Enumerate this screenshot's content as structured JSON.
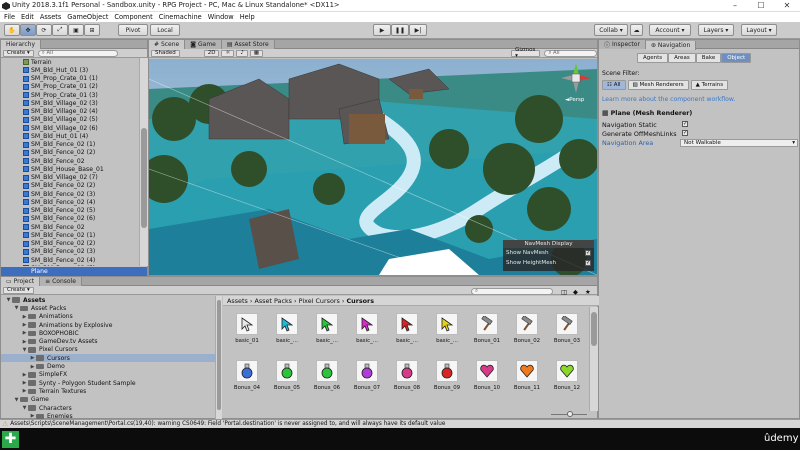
{
  "window": {
    "title": "Unity 2018.3.1f1 Personal - Sandbox.unity - RPG Project - PC, Mac & Linux Standalone* <DX11>",
    "min": "–",
    "max": "☐",
    "close": "✕"
  },
  "menu": [
    "File",
    "Edit",
    "Assets",
    "GameObject",
    "Component",
    "Cinemachine",
    "Window",
    "Help"
  ],
  "toolbar": {
    "pivot": "Pivot",
    "local": "Local",
    "collab": "Collab ▾",
    "account": "Account ▾",
    "layers": "Layers ▾",
    "layout": "Layout ▾"
  },
  "hierarchy": {
    "tab": "Hierarchy",
    "create": "Create ▾",
    "search_placeholder": "All",
    "items": [
      "Terrain",
      "SM_Bld_Hut_01 (3)",
      "SM_Prop_Crate_01 (1)",
      "SM_Prop_Crate_01 (2)",
      "SM_Prop_Crate_01 (3)",
      "SM_Bld_Village_02 (3)",
      "SM_Bld_Village_02 (4)",
      "SM_Bld_Village_02 (5)",
      "SM_Bld_Village_02 (6)",
      "SM_Bld_Hut_01 (4)",
      "SM_Bld_Fence_02 (1)",
      "SM_Bld_Fence_02 (2)",
      "SM_Bld_Fence_02",
      "SM_Bld_House_Base_01",
      "SM_Bld_Village_02 (7)",
      "SM_Bld_Fence_02 (2)",
      "SM_Bld_Fence_02 (3)",
      "SM_Bld_Fence_02 (4)",
      "SM_Bld_Fence_02 (5)",
      "SM_Bld_Fence_02 (6)",
      "SM_Bld_Fence_02",
      "SM_Bld_Fence_02 (1)",
      "SM_Bld_Fence_02 (2)",
      "SM_Bld_Fence_02 (3)",
      "SM_Bld_Fence_02 (4)",
      "SM_Bld_Fence_02 (5)"
    ],
    "selected": "Plane"
  },
  "scene": {
    "tabs": [
      "Scene",
      "Game",
      "Asset Store"
    ],
    "shading": "Shaded",
    "mode_2d": "2D",
    "gizmos": "Gizmos ▾",
    "search_placeholder": "All",
    "persp": "◄Persp",
    "navmesh_display": {
      "title": "NavMesh Display",
      "show_navmesh": "Show NavMesh",
      "show_heightmesh": "Show HeightMesh"
    }
  },
  "inspector": {
    "tabs": [
      "Inspector",
      "Navigation"
    ],
    "subtabs": [
      "Agents",
      "Areas",
      "Bake",
      "Object"
    ],
    "scene_filter_label": "Scene Filter:",
    "filter_all": "All",
    "filter_mesh": "Mesh Renderers",
    "filter_terrains": "Terrains",
    "learn_more": "Learn more about the component workflow.",
    "object_title": "Plane (Mesh Renderer)",
    "nav_static": "Navigation Static",
    "offmesh": "Generate OffMeshLinks",
    "nav_area_label": "Navigation Area",
    "nav_area_value": "Not Walkable"
  },
  "project": {
    "tabs": [
      "Project",
      "Console"
    ],
    "create": "Create ▾",
    "tree": [
      {
        "label": "Assets",
        "depth": 0,
        "open": true
      },
      {
        "label": "Asset Packs",
        "depth": 1,
        "open": true
      },
      {
        "label": "Animations",
        "depth": 2,
        "open": false
      },
      {
        "label": "Animations by Explosive",
        "depth": 2,
        "open": false
      },
      {
        "label": "BOXOPHOBIC",
        "depth": 2,
        "open": false
      },
      {
        "label": "GameDev.tv Assets",
        "depth": 2,
        "open": false
      },
      {
        "label": "Pixel Cursors",
        "depth": 2,
        "open": true
      },
      {
        "label": "Cursors",
        "depth": 3,
        "open": false,
        "selected": true
      },
      {
        "label": "Demo",
        "depth": 3,
        "open": false
      },
      {
        "label": "SimpleFX",
        "depth": 2,
        "open": false
      },
      {
        "label": "Synty - Polygon Student Sample",
        "depth": 2,
        "open": false
      },
      {
        "label": "Terrain Textures",
        "depth": 2,
        "open": false
      },
      {
        "label": "Game",
        "depth": 1,
        "open": true
      },
      {
        "label": "Characters",
        "depth": 2,
        "open": true
      },
      {
        "label": "Enemies",
        "depth": 3,
        "open": false
      }
    ],
    "breadcrumb": [
      "Assets",
      "Asset Packs",
      "Pixel Cursors",
      "Cursors"
    ],
    "assets_row1": [
      {
        "label": "basic_01",
        "color": "#e8e8e8",
        "shape": "arrow"
      },
      {
        "label": "basic_...",
        "color": "#22b8d8",
        "shape": "arrow"
      },
      {
        "label": "basic_...",
        "color": "#2bc43a",
        "shape": "arrow"
      },
      {
        "label": "basic_...",
        "color": "#d62bc8",
        "shape": "arrow"
      },
      {
        "label": "basic_...",
        "color": "#d82424",
        "shape": "arrow"
      },
      {
        "label": "basic_...",
        "color": "#e6d21e",
        "shape": "arrow"
      },
      {
        "label": "Bonus_01",
        "color": "#8a6a4a",
        "shape": "hammer"
      },
      {
        "label": "Bonus_02",
        "color": "#8a6a4a",
        "shape": "hammer"
      },
      {
        "label": "Bonus_03",
        "color": "#8a6a4a",
        "shape": "hammer"
      }
    ],
    "assets_row2": [
      {
        "label": "Bonus_04",
        "color": "#3a6ed8",
        "shape": "potion"
      },
      {
        "label": "Bonus_05",
        "color": "#2bc43a",
        "shape": "potion"
      },
      {
        "label": "Bonus_06",
        "color": "#2bc43a",
        "shape": "potion"
      },
      {
        "label": "Bonus_07",
        "color": "#b23ad8",
        "shape": "potion"
      },
      {
        "label": "Bonus_08",
        "color": "#d83a8a",
        "shape": "potion"
      },
      {
        "label": "Bonus_09",
        "color": "#d82424",
        "shape": "potion"
      },
      {
        "label": "Bonus_10",
        "color": "#d83a8a",
        "shape": "heart"
      },
      {
        "label": "Bonus_11",
        "color": "#f07a1e",
        "shape": "heart"
      },
      {
        "label": "Bonus_12",
        "color": "#8ad82a",
        "shape": "heart"
      }
    ]
  },
  "status": {
    "message": "Assets\\Scripts\\SceneManagement\\Portal.cs(19,40): warning CS0649: Field 'Portal.destination' is never assigned to, and will always have its default value"
  },
  "brand": {
    "udemy": "ûdemy"
  }
}
